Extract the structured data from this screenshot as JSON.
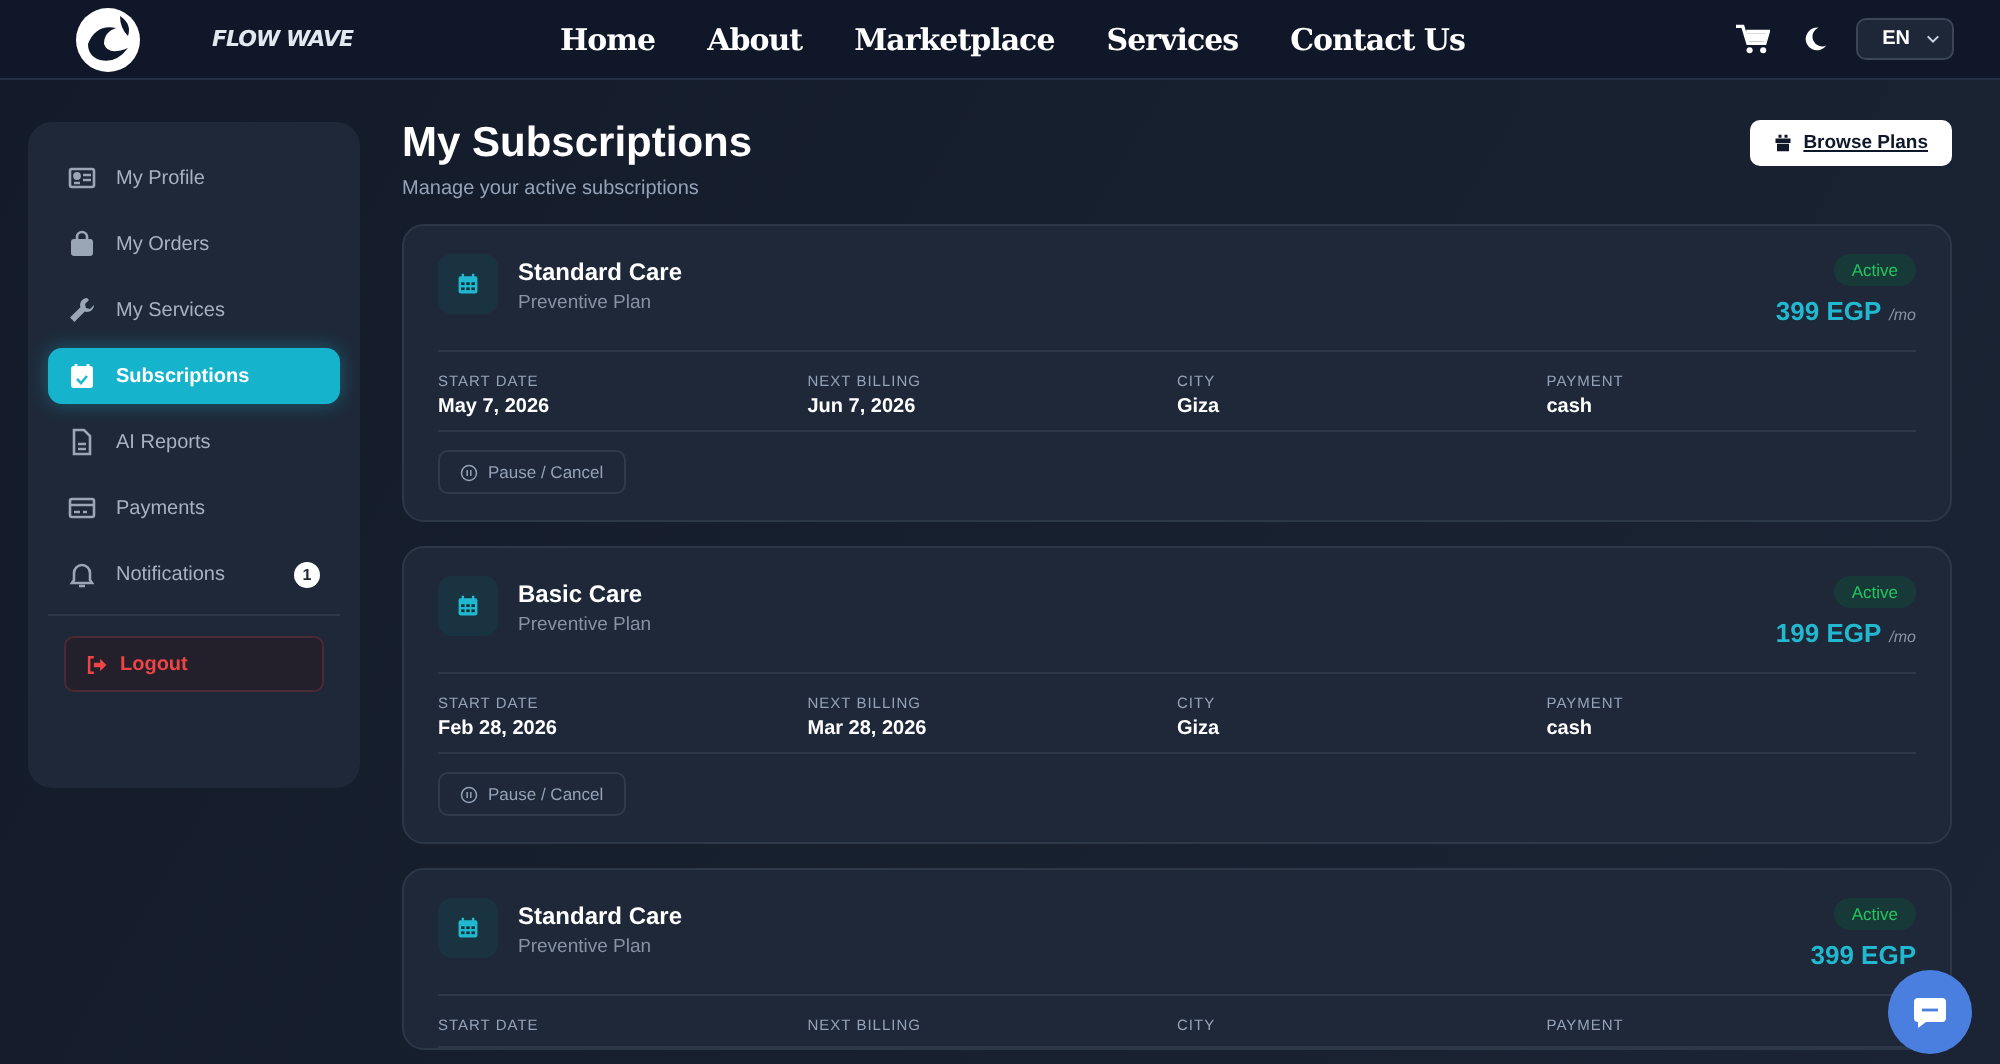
{
  "brand": {
    "name": "FLOW WAVE"
  },
  "nav": [
    {
      "label": "Home"
    },
    {
      "label": "About"
    },
    {
      "label": "Marketplace"
    },
    {
      "label": "Services"
    },
    {
      "label": "Contact Us"
    }
  ],
  "language": {
    "value": "EN"
  },
  "sidebar": {
    "items": [
      {
        "label": "My Profile",
        "kind": "profile",
        "selected": false
      },
      {
        "label": "My Orders",
        "kind": "orders",
        "selected": false
      },
      {
        "label": "My Services",
        "kind": "services",
        "selected": false
      },
      {
        "label": "Subscriptions",
        "kind": "subscriptions",
        "selected": true
      },
      {
        "label": "AI Reports",
        "kind": "reports",
        "selected": false
      },
      {
        "label": "Payments",
        "kind": "payments",
        "selected": false
      },
      {
        "label": "Notifications",
        "kind": "notifications",
        "selected": false,
        "badge": "1"
      }
    ],
    "logout": "Logout"
  },
  "page": {
    "title": "My Subscriptions",
    "subtitle": "Manage your active subscriptions",
    "browse_button": "Browse Plans"
  },
  "subscriptions": [
    {
      "name": "Standard Care",
      "plan": "Preventive Plan",
      "status": "Active",
      "price": "399 EGP",
      "period": "/mo",
      "fields": [
        {
          "label": "START DATE",
          "value": "May 7, 2026"
        },
        {
          "label": "NEXT BILLING",
          "value": "Jun 7, 2026"
        },
        {
          "label": "CITY",
          "value": "Giza"
        },
        {
          "label": "PAYMENT",
          "value": "cash"
        }
      ],
      "action": "Pause / Cancel"
    },
    {
      "name": "Basic Care",
      "plan": "Preventive Plan",
      "status": "Active",
      "price": "199 EGP",
      "period": "/mo",
      "fields": [
        {
          "label": "START DATE",
          "value": "Feb 28, 2026"
        },
        {
          "label": "NEXT BILLING",
          "value": "Mar 28, 2026"
        },
        {
          "label": "CITY",
          "value": "Giza"
        },
        {
          "label": "PAYMENT",
          "value": "cash"
        }
      ],
      "action": "Pause / Cancel"
    },
    {
      "name": "Standard Care",
      "plan": "Preventive Plan",
      "status": "Active",
      "price": "399 EGP",
      "fields": [
        {
          "label": "START DATE"
        },
        {
          "label": "NEXT BILLING"
        },
        {
          "label": "CITY"
        },
        {
          "label": "PAYMENT"
        }
      ]
    }
  ]
}
